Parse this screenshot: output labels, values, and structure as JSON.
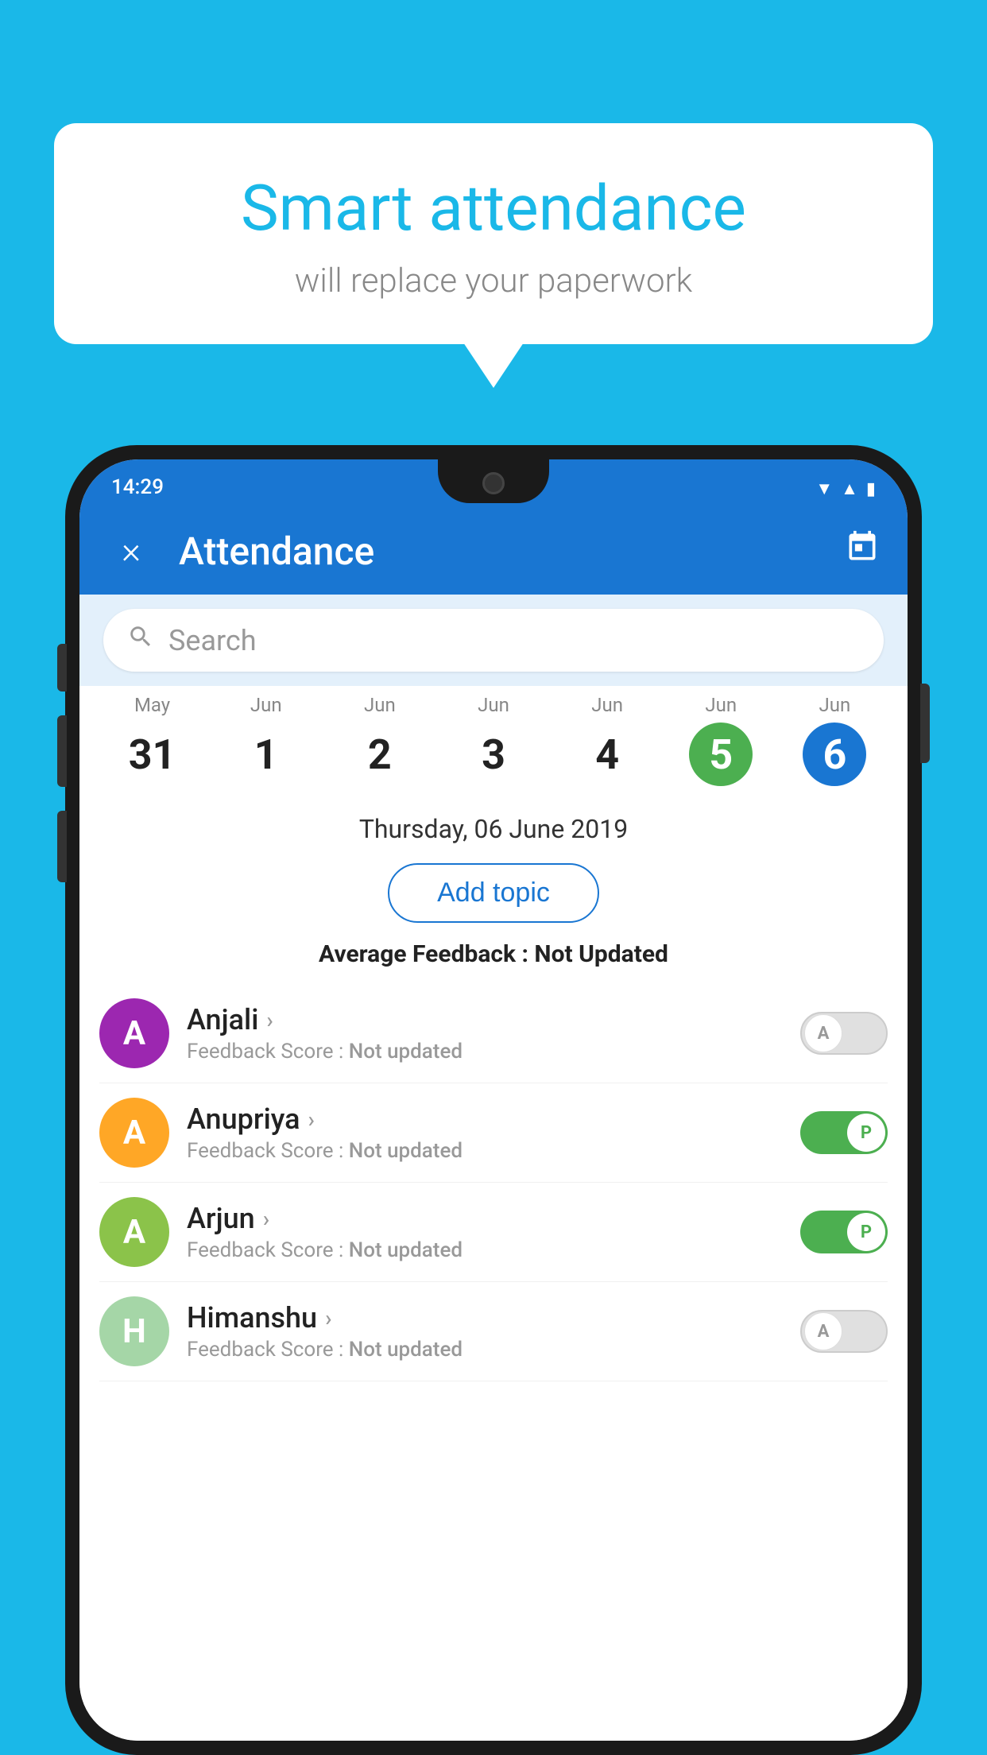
{
  "background_color": "#1ab8e8",
  "bubble": {
    "title": "Smart attendance",
    "subtitle": "will replace your paperwork"
  },
  "status_bar": {
    "time": "14:29",
    "icons": [
      "wifi",
      "signal",
      "battery"
    ]
  },
  "app_bar": {
    "title": "Attendance",
    "close_label": "×",
    "calendar_label": "📅"
  },
  "search": {
    "placeholder": "Search"
  },
  "calendar": {
    "days": [
      {
        "month": "May",
        "date": "31",
        "state": "normal"
      },
      {
        "month": "Jun",
        "date": "1",
        "state": "normal"
      },
      {
        "month": "Jun",
        "date": "2",
        "state": "normal"
      },
      {
        "month": "Jun",
        "date": "3",
        "state": "normal"
      },
      {
        "month": "Jun",
        "date": "4",
        "state": "normal"
      },
      {
        "month": "Jun",
        "date": "5",
        "state": "today"
      },
      {
        "month": "Jun",
        "date": "6",
        "state": "selected"
      }
    ]
  },
  "selected_date_label": "Thursday, 06 June 2019",
  "add_topic_label": "Add topic",
  "avg_feedback_label": "Average Feedback :",
  "avg_feedback_value": "Not Updated",
  "students": [
    {
      "name": "Anjali",
      "avatar_letter": "A",
      "avatar_color": "#9c27b0",
      "feedback_label": "Feedback Score :",
      "feedback_value": "Not updated",
      "toggle_state": "off",
      "toggle_label": "A"
    },
    {
      "name": "Anupriya",
      "avatar_letter": "A",
      "avatar_color": "#ffa726",
      "feedback_label": "Feedback Score :",
      "feedback_value": "Not updated",
      "toggle_state": "on",
      "toggle_label": "P"
    },
    {
      "name": "Arjun",
      "avatar_letter": "A",
      "avatar_color": "#8bc34a",
      "feedback_label": "Feedback Score :",
      "feedback_value": "Not updated",
      "toggle_state": "on",
      "toggle_label": "P"
    },
    {
      "name": "Himanshu",
      "avatar_letter": "H",
      "avatar_color": "#a5d6a7",
      "feedback_label": "Feedback Score :",
      "feedback_value": "Not updated",
      "toggle_state": "off",
      "toggle_label": "A"
    }
  ]
}
